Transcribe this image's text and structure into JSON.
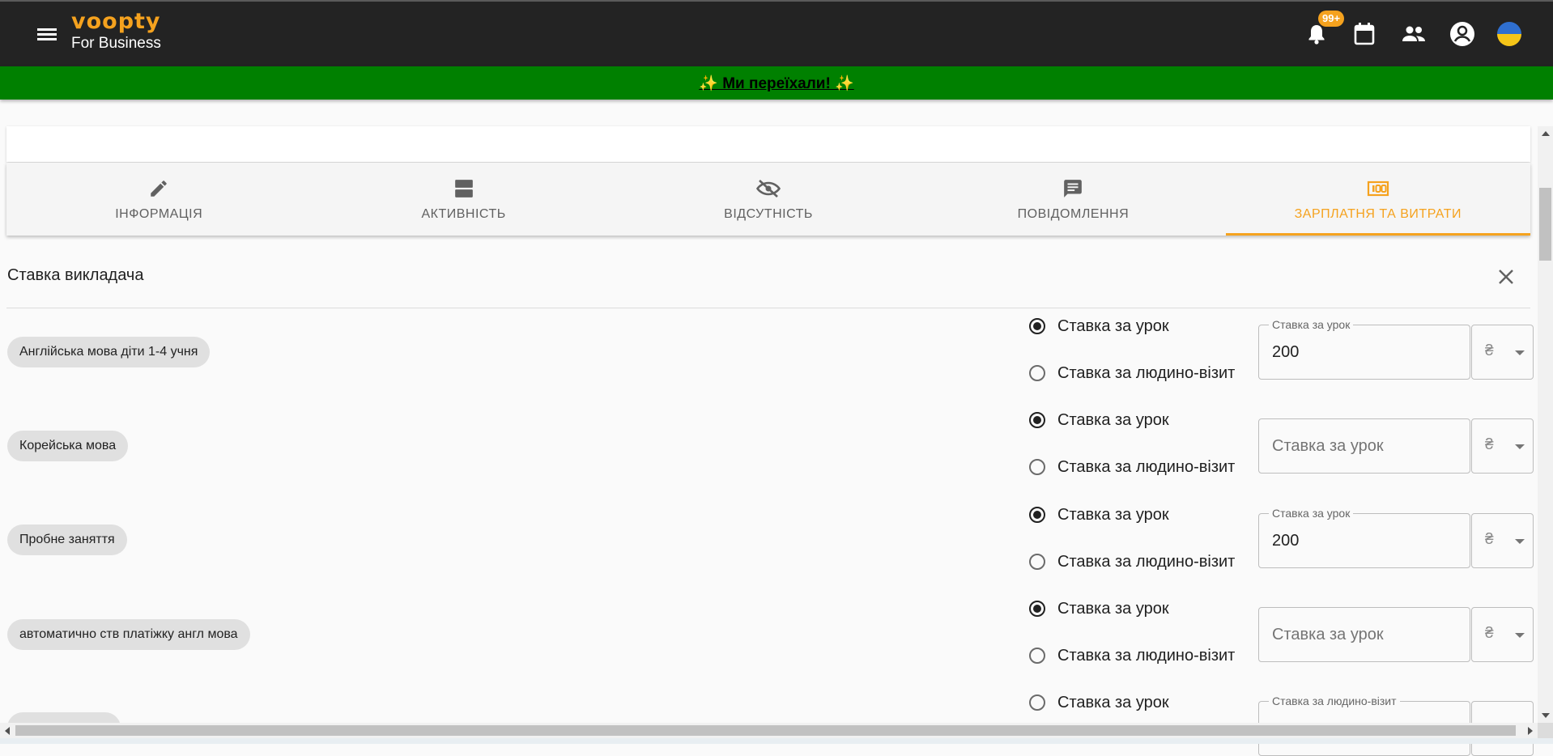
{
  "header": {
    "brand_logo": "voopty",
    "brand_sub": "For Business",
    "notification_count": "99+",
    "icons": [
      "menu-icon",
      "bell-icon",
      "calendar-icon",
      "people-icon",
      "account-icon",
      "ukraine-flag-icon"
    ]
  },
  "notice": {
    "text": "✨ Ми переїхали! ✨"
  },
  "tabs": [
    {
      "label": "ІНФОРМАЦІЯ",
      "icon": "pencil-icon"
    },
    {
      "label": "АКТИВНІСТЬ",
      "icon": "view-agenda-icon"
    },
    {
      "label": "ВІДСУТНІСТЬ",
      "icon": "eye-off-icon"
    },
    {
      "label": "ПОВІДОМЛЕННЯ",
      "icon": "message-icon"
    },
    {
      "label": "ЗАРПЛАТНЯ ТА ВИТРАТИ",
      "icon": "money-icon",
      "active": true
    }
  ],
  "section": {
    "title": "Ставка викладача"
  },
  "courses": [
    {
      "name": "Англійська мова діти 1-4 учня",
      "option1": "Ставка за урок",
      "option2": "Ставка за людино-візит",
      "selected": 1,
      "field_label": "Ставка за урок",
      "value": "200",
      "placeholder": "",
      "currency": "₴"
    },
    {
      "name": "Корейська мова",
      "option1": "Ставка за урок",
      "option2": "Ставка за людино-візит",
      "selected": 1,
      "field_label": "",
      "value": "",
      "placeholder": "Ставка за урок",
      "currency": "₴"
    },
    {
      "name": "Пробне заняття",
      "option1": "Ставка за урок",
      "option2": "Ставка за людино-візит",
      "selected": 1,
      "field_label": "Ставка за урок",
      "value": "200",
      "placeholder": "",
      "currency": "₴"
    },
    {
      "name": "автоматично ств платіжку англ мова",
      "option1": "Ставка за урок",
      "option2": "Ставка за людино-візит",
      "selected": 1,
      "field_label": "",
      "value": "",
      "placeholder": "Ставка за урок",
      "currency": "₴"
    },
    {
      "name": "",
      "option1": "Ставка за урок",
      "selected": 2,
      "field_label": "Ставка за людино-візит",
      "value": "",
      "placeholder": "",
      "currency": ""
    }
  ],
  "colors": {
    "accent": "#f5a21e",
    "topbar": "#232323",
    "notice": "#008000"
  }
}
